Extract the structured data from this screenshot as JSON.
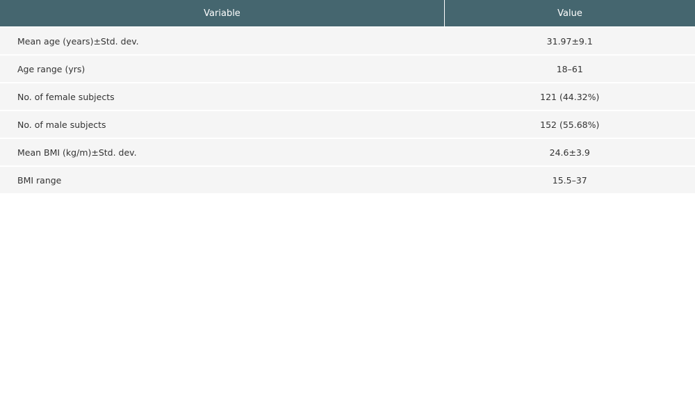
{
  "table": {
    "headers": {
      "variable": "Variable",
      "value": "Value"
    },
    "rows": [
      {
        "variable": "Mean age (years)±Std. dev.",
        "value": "31.97±9.1"
      },
      {
        "variable": "Age range (yrs)",
        "value": "18–61"
      },
      {
        "variable": "No. of female subjects",
        "value": "121 (44.32%)"
      },
      {
        "variable": "No. of male subjects",
        "value": "152 (55.68%)"
      },
      {
        "variable": "Mean BMI (kg/m)±Std. dev.",
        "value": "24.6±3.9"
      },
      {
        "variable": "BMI range",
        "value": "15.5–37"
      }
    ]
  },
  "colors": {
    "header_bg": "#45666f",
    "row_bg": "#f5f5f5"
  }
}
